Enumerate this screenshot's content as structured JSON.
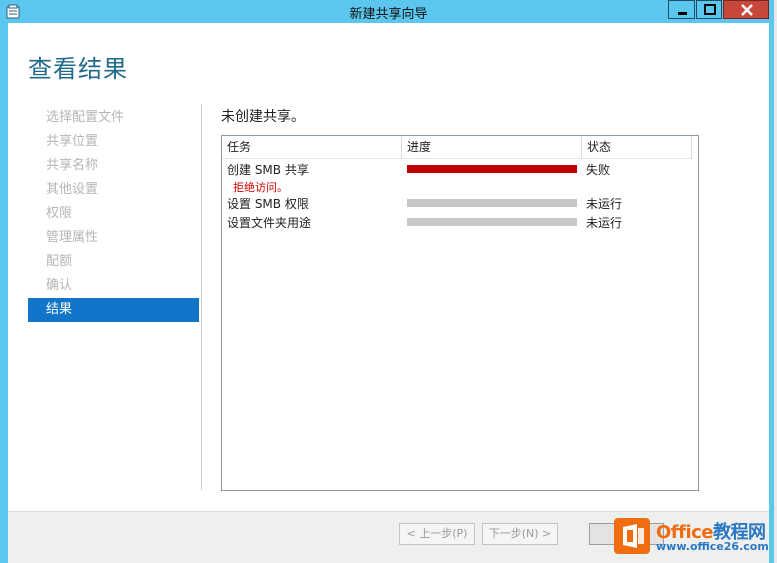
{
  "window": {
    "title": "新建共享向导"
  },
  "heading": "查看结果",
  "nav": {
    "items": [
      {
        "label": "选择配置文件",
        "active": false
      },
      {
        "label": "共享位置",
        "active": false
      },
      {
        "label": "共享名称",
        "active": false
      },
      {
        "label": "其他设置",
        "active": false
      },
      {
        "label": "权限",
        "active": false
      },
      {
        "label": "管理属性",
        "active": false
      },
      {
        "label": "配额",
        "active": false
      },
      {
        "label": "确认",
        "active": false
      },
      {
        "label": "结果",
        "active": true
      }
    ]
  },
  "content": {
    "status_message": "未创建共享。",
    "table": {
      "headers": {
        "task": "任务",
        "progress": "进度",
        "status": "状态"
      },
      "rows": [
        {
          "task": "创建 SMB 共享",
          "error": "拒绝访问。",
          "status": "失败",
          "progress_fraction": 1.0,
          "bar_color": "#c00000"
        },
        {
          "task": "设置 SMB 权限",
          "error": "",
          "status": "未运行",
          "progress_fraction": 0,
          "bar_color": "#c8c8c8"
        },
        {
          "task": "设置文件夹用途",
          "error": "",
          "status": "未运行",
          "progress_fraction": 0,
          "bar_color": "#c8c8c8"
        }
      ]
    }
  },
  "footer": {
    "prev_label": "< 上一步(P)",
    "next_label": "下一步(N) >",
    "close_label": ""
  },
  "watermark": {
    "brand_main": "Office",
    "brand_tail": "教程网",
    "url": "www.office26.com"
  },
  "colors": {
    "titlebar": "#5cc7ee",
    "accent": "#1176c9",
    "heading": "#1f6a8a",
    "error_bar": "#c00000",
    "idle_bar": "#c8c8c8",
    "error_text": "#d20000"
  }
}
